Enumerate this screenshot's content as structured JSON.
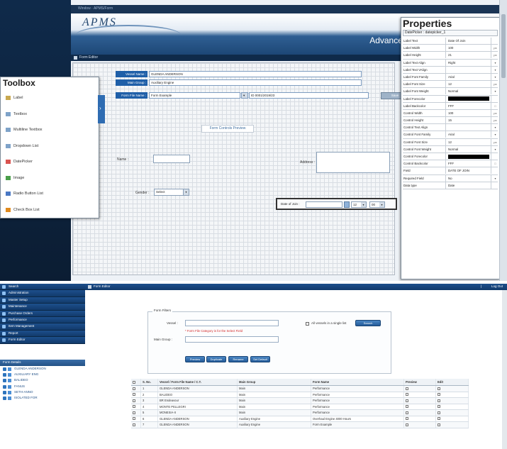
{
  "top": {
    "address_text": "Window · APMS/Form",
    "logo": "APMS",
    "banner": "Advanced Planned Maintenance",
    "doc_tab": "Form Editor",
    "form": {
      "rows": [
        {
          "label": "Vessel Name :",
          "value": "GLENDA ANDERSON"
        },
        {
          "label": "Main Group :",
          "value": "Auxiliary Engine"
        },
        {
          "label": "Form File Name :",
          "value": "Form Example",
          "extra": "ID 0001/2019/23"
        }
      ],
      "save_label": "Save",
      "section_title": "Form Controls Preview",
      "name_label": "Name :",
      "address_label": "Address :",
      "gender_label": "Gender :",
      "gender_value": "Select",
      "date_label": "Date of Join :",
      "hour_value": "12",
      "minute_value": "00"
    },
    "toolbox": {
      "title": "Toolbox",
      "items": [
        {
          "label": "Label",
          "color": "#c8a850"
        },
        {
          "label": "Textbox",
          "color": "#7fa3c9"
        },
        {
          "label": "Multiline Textbox",
          "color": "#7fa3c9"
        },
        {
          "label": "Dropdown List",
          "color": "#7fa3c9"
        },
        {
          "label": "DatePicker",
          "color": "#d9534f"
        },
        {
          "label": "Image",
          "color": "#4a9e4a"
        },
        {
          "label": "Radio Button List",
          "color": "#4a78c4"
        },
        {
          "label": "Check Box List",
          "color": "#e08a1e"
        }
      ]
    },
    "properties": {
      "title": "Properties",
      "subtitle": "DatePicker : datepicker_1",
      "rows": [
        {
          "k": "Label Text",
          "v": "Date Of Join",
          "u": ""
        },
        {
          "k": "Label Width",
          "v": "100",
          "u": "px"
        },
        {
          "k": "Label Height",
          "v": "21",
          "u": "px"
        },
        {
          "k": "Label Text Align",
          "v": "Right",
          "u": "▾"
        },
        {
          "k": "Label Text VAlign",
          "v": "",
          "u": "▾"
        },
        {
          "k": "Label Font Family",
          "v": "Arial",
          "u": "▾"
        },
        {
          "k": "Label Font Size",
          "v": "12",
          "u": "px"
        },
        {
          "k": "Label Font Weight",
          "v": "Normal",
          "u": "▾"
        },
        {
          "k": "Label Forecolor",
          "v": "",
          "u": "",
          "swatch": true
        },
        {
          "k": "Label Backcolor",
          "v": "FFF",
          "u": "□"
        },
        {
          "k": "Control Width",
          "v": "100",
          "u": "px"
        },
        {
          "k": "Control Height",
          "v": "15",
          "u": "px"
        },
        {
          "k": "Control Text Align",
          "v": "",
          "u": "▾"
        },
        {
          "k": "Control Font Family",
          "v": "Arial",
          "u": "▾"
        },
        {
          "k": "Control Font Size",
          "v": "12",
          "u": "px"
        },
        {
          "k": "Control Font Weight",
          "v": "Normal",
          "u": "▾"
        },
        {
          "k": "Control Forecolor",
          "v": "",
          "u": "",
          "swatch": true
        },
        {
          "k": "Control Backcolor",
          "v": "FFF",
          "u": "□"
        },
        {
          "k": "Field",
          "v": "DATE OF JOIN",
          "u": ""
        },
        {
          "k": "Required Field",
          "v": "No",
          "u": "▾"
        },
        {
          "k": "Data type",
          "v": "Date",
          "u": ""
        }
      ]
    }
  },
  "bottom": {
    "nav": [
      "Search",
      "Administration",
      "Master Setup",
      "Maintenance",
      "Purchase Orders",
      "Performance",
      "Item Management",
      "Report",
      "Form Editor"
    ],
    "tree_head": "Form Details",
    "tree": [
      "GLENDA ANDERSON",
      "AUXILIARY ENG",
      "BALIDEO",
      "FANUS",
      "SETH-ANNO",
      "ISOLATED FOR"
    ],
    "topbar_title": "Form Editor",
    "logout": "Log Out",
    "filter": {
      "legend": "Form Filters",
      "vessel_label": "Vessel :",
      "error": "* Form File Category is for the Select Field",
      "main_group_label": "Main Group :",
      "checkbox_label": "All vessels in a single list",
      "search_btn": "Search",
      "buttons": [
        "Preview",
        "Duplicate",
        "Rename",
        "Set Default"
      ]
    },
    "grid": {
      "headers": [
        "",
        "S. No.",
        "Vessel / Form File Name / C.T.",
        "Main Group",
        "Form Name",
        "Preview",
        "Edit"
      ],
      "rows": [
        [
          "",
          "1",
          "GLENDA ANDERSON",
          "Main",
          "Performance",
          "",
          ""
        ],
        [
          "",
          "2",
          "BALIDEO",
          "Main",
          "Performance",
          "",
          ""
        ],
        [
          "",
          "3",
          "BR Endeavour",
          "Main",
          "Performance",
          "",
          ""
        ],
        [
          "",
          "4",
          "MONTE PELLEGRI",
          "Main",
          "Performance",
          "",
          ""
        ],
        [
          "",
          "5",
          "MONESIA-II",
          "Main",
          "Performance",
          "",
          ""
        ],
        [
          "",
          "6",
          "GLENDA ANDERSON",
          "Auxiliary Engine",
          "Overhaul Engine 4000 Hours",
          "",
          ""
        ],
        [
          "",
          "7",
          "GLENDA ANDERSON",
          "Auxiliary Engine",
          "Form Example",
          "",
          ""
        ]
      ]
    }
  }
}
